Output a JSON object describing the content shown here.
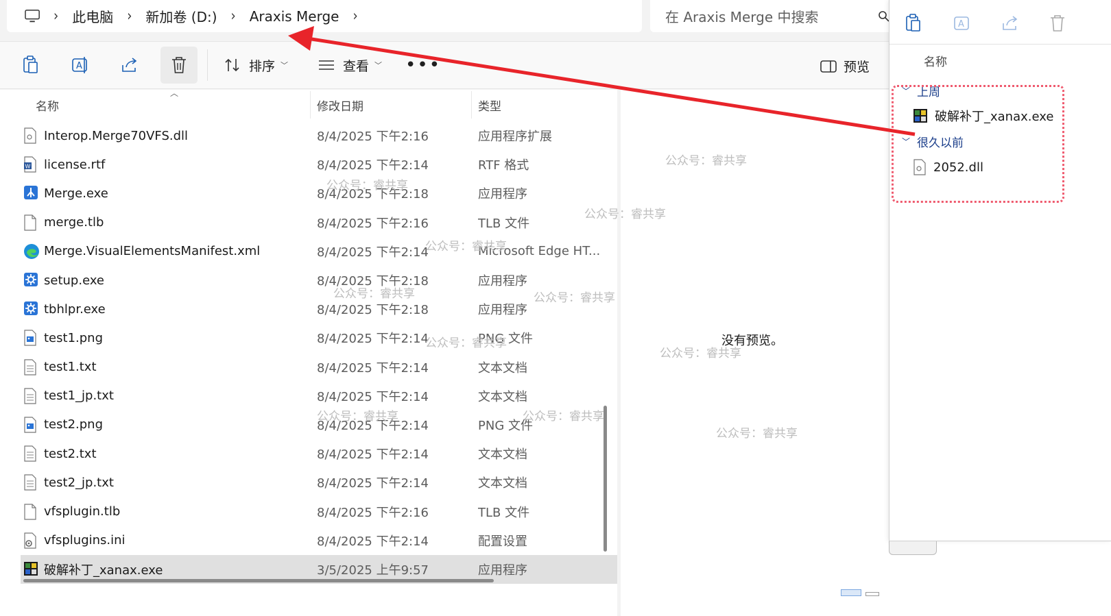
{
  "breadcrumb": {
    "items": [
      "此电脑",
      "新加卷 (D:)",
      "Araxis Merge"
    ]
  },
  "search": {
    "placeholder": "在 Araxis Merge 中搜索"
  },
  "toolbar": {
    "sort_label": "排序",
    "view_label": "查看",
    "more_label": "•••",
    "preview_label": "预览"
  },
  "columns": {
    "name": "名称",
    "modified": "修改日期",
    "type": "类型"
  },
  "files": [
    {
      "name": "Interop.Merge70VFS.dll",
      "date": "8/4/2025 下午2:16",
      "type": "应用程序扩展",
      "icon": "dll-icon"
    },
    {
      "name": "license.rtf",
      "date": "8/4/2025 下午2:14",
      "type": "RTF 格式",
      "icon": "word-doc-icon"
    },
    {
      "name": "Merge.exe",
      "date": "8/4/2025 下午2:18",
      "type": "应用程序",
      "icon": "merge-app-icon"
    },
    {
      "name": "merge.tlb",
      "date": "8/4/2025 下午2:16",
      "type": "TLB 文件",
      "icon": "blank-file-icon"
    },
    {
      "name": "Merge.VisualElementsManifest.xml",
      "date": "8/4/2025 下午2:14",
      "type": "Microsoft Edge HT...",
      "icon": "edge-icon"
    },
    {
      "name": "setup.exe",
      "date": "8/4/2025 下午2:18",
      "type": "应用程序",
      "icon": "gear-app-icon"
    },
    {
      "name": "tbhlpr.exe",
      "date": "8/4/2025 下午2:18",
      "type": "应用程序",
      "icon": "gear-app-icon"
    },
    {
      "name": "test1.png",
      "date": "8/4/2025 下午2:14",
      "type": "PNG 文件",
      "icon": "image-file-icon"
    },
    {
      "name": "test1.txt",
      "date": "8/4/2025 下午2:14",
      "type": "文本文档",
      "icon": "text-file-icon"
    },
    {
      "name": "test1_jp.txt",
      "date": "8/4/2025 下午2:14",
      "type": "文本文档",
      "icon": "text-file-icon"
    },
    {
      "name": "test2.png",
      "date": "8/4/2025 下午2:14",
      "type": "PNG 文件",
      "icon": "image-file-icon"
    },
    {
      "name": "test2.txt",
      "date": "8/4/2025 下午2:14",
      "type": "文本文档",
      "icon": "text-file-icon"
    },
    {
      "name": "test2_jp.txt",
      "date": "8/4/2025 下午2:14",
      "type": "文本文档",
      "icon": "text-file-icon"
    },
    {
      "name": "vfsplugin.tlb",
      "date": "8/4/2025 下午2:16",
      "type": "TLB 文件",
      "icon": "blank-file-icon"
    },
    {
      "name": "vfsplugins.ini",
      "date": "8/4/2025 下午2:14",
      "type": "配置设置",
      "icon": "ini-file-icon"
    },
    {
      "name": "破解补丁_xanax.exe",
      "date": "3/5/2025 上午9:57",
      "type": "应用程序",
      "icon": "patch-app-icon",
      "selected": true
    }
  ],
  "preview": {
    "empty_text": "没有预览。"
  },
  "watermark": "公众号：睿共享",
  "popup": {
    "column_name": "名称",
    "groups": [
      {
        "label": "上周",
        "items": [
          "破解补丁_xanax.exe"
        ]
      },
      {
        "label": "很久以前",
        "items": [
          "2052.dll"
        ]
      }
    ]
  },
  "colors": {
    "arrow": "#e8242a",
    "highlight_box": "#ef5a6e",
    "group_label": "#1a3d8a",
    "selection": "#e0e0e0"
  }
}
